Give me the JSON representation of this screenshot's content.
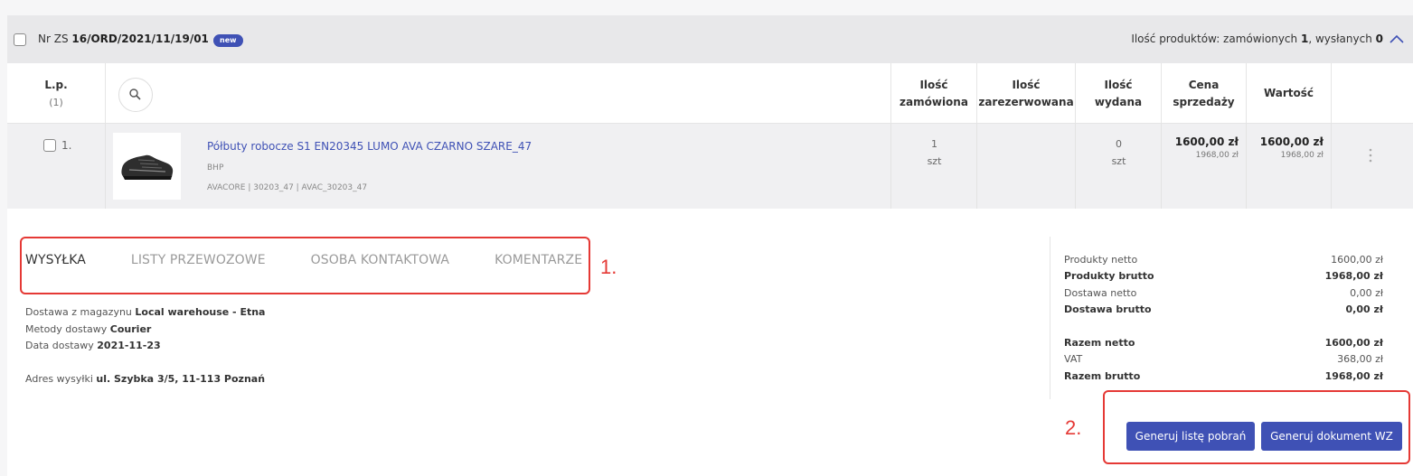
{
  "order": {
    "prefix": "Nr ZS",
    "number": "16/ORD/2021/11/19/01",
    "badge": "new",
    "count_label": "Ilość produktów: zamówionych",
    "ordered": "1",
    "sent_label": ", wysłanych",
    "sent": "0"
  },
  "table": {
    "headers": {
      "lp": "L.p.",
      "lp_count": "(1)",
      "ordered_1": "Ilość",
      "ordered_2": "zamówiona",
      "reserved_1": "Ilość",
      "reserved_2": "zarezerwowana",
      "issued_1": "Ilość",
      "issued_2": "wydana",
      "price_1": "Cena",
      "price_2": "sprzedaży",
      "value": "Wartość"
    },
    "row": {
      "lp": "1.",
      "name": "Półbuty robocze S1 EN20345 LUMO AVA CZARNO SZARE_47",
      "category": "BHP",
      "codes": "AVACORE | 30203_47 | AVAC_30203_47",
      "qty_ordered": "1",
      "qty_ordered_unit": "szt",
      "qty_issued": "0",
      "qty_issued_unit": "szt",
      "price_net": "1600,00 zł",
      "price_gross": "1968,00 zł",
      "value_net": "1600,00 zł",
      "value_gross": "1968,00 zł"
    }
  },
  "tabs": [
    "WYSYŁKA",
    "LISTY PRZEWOZOWE",
    "OSOBA KONTAKTOWA",
    "KOMENTARZE"
  ],
  "annotations": {
    "one": "1.",
    "two": "2."
  },
  "shipping": {
    "warehouse_label": "Dostawa z magazynu",
    "warehouse": "Local warehouse - Etna",
    "method_label": "Metody dostawy",
    "method": "Courier",
    "date_label": "Data dostawy",
    "date": "2021-11-23",
    "address_label": "Adres wysyłki",
    "address": "ul. Szybka 3/5, 11-113 Poznań"
  },
  "summary": [
    {
      "label": "Produkty netto",
      "value": "1600,00 zł",
      "bold": false
    },
    {
      "label": "Produkty brutto",
      "value": "1968,00 zł",
      "bold": true
    },
    {
      "label": "Dostawa netto",
      "value": "0,00 zł",
      "bold": false
    },
    {
      "label": "Dostawa brutto",
      "value": "0,00 zł",
      "bold": true
    },
    {
      "label": "Razem netto",
      "value": "1600,00 zł",
      "bold": true
    },
    {
      "label": "VAT",
      "value": "368,00 zł",
      "bold": false
    },
    {
      "label": "Razem brutto",
      "value": "1968,00 zł",
      "bold": true
    }
  ],
  "buttons": {
    "picklist": "Generuj listę pobrań",
    "wz": "Generuj dokument WZ"
  },
  "colors": {
    "accent": "#3f51b5",
    "annotation": "#e53935"
  }
}
